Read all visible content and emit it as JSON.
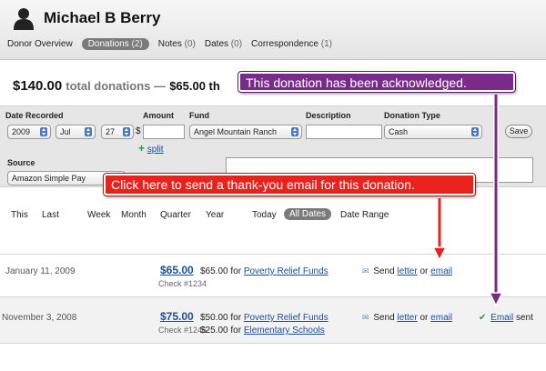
{
  "header": {
    "donor_name": "Michael B Berry",
    "tabs": [
      {
        "label": "Donor Overview",
        "count": ""
      },
      {
        "label": "Donations",
        "count": "(2)"
      },
      {
        "label": "Notes",
        "count": "(0)"
      },
      {
        "label": "Dates",
        "count": "(0)"
      },
      {
        "label": "Correspondence",
        "count": "(1)"
      }
    ]
  },
  "summary": {
    "total_amount": "$140.00",
    "total_label": "total donations —",
    "partial": "$65.00 th"
  },
  "form": {
    "labels": {
      "date_recorded": "Date Recorded",
      "amount": "Amount",
      "fund": "Fund",
      "description": "Description",
      "donation_type": "Donation Type",
      "source": "Source"
    },
    "year": "2009",
    "month": "Jul",
    "day": "27",
    "currency_symbol": "$",
    "fund_value": "Angel Mountain Ranch",
    "donation_type_value": "Cash",
    "source_value": "Amazon Simple Pay",
    "save_label": "Save",
    "split_label": "split",
    "split_plus": "+"
  },
  "periods": {
    "items": [
      "This",
      "Last",
      "Week",
      "Month",
      "Quarter",
      "Year",
      "Today"
    ],
    "active": "All Dates",
    "date_range": "Date Range"
  },
  "donations": [
    {
      "date": "January 11, 2009",
      "amount": "$65.00",
      "check": "Check #1234",
      "lines": [
        {
          "amount": "$65.00",
          "for": "for",
          "fund": "Poverty Relief Funds"
        }
      ],
      "send": "Send",
      "letter": "letter",
      "or": "or",
      "email": "email",
      "status": ""
    },
    {
      "date": "November 3, 2008",
      "amount": "$75.00",
      "check": "Check #1245",
      "lines": [
        {
          "amount": "$50.00",
          "for": "for",
          "fund": "Poverty Relief Funds"
        },
        {
          "amount": "$25.00",
          "for": "for",
          "fund": "Elementary Schools"
        }
      ],
      "send": "Send",
      "letter": "letter",
      "or": "or",
      "email": "email",
      "status_link": "Email",
      "status_text": "sent"
    }
  ],
  "callouts": {
    "acknowledged": "This donation has been acknowledged.",
    "thank_you": "Click here to send a thank-you email for this donation."
  },
  "colors": {
    "purple_callout": "#7a2b8a",
    "red_callout": "#e8231e",
    "link": "#1a4fa0",
    "active_pill": "#7b7b7b"
  },
  "icons": [
    "person-icon",
    "plus-icon",
    "envelope-icon",
    "checkmark-icon",
    "select-arrows-icon"
  ]
}
